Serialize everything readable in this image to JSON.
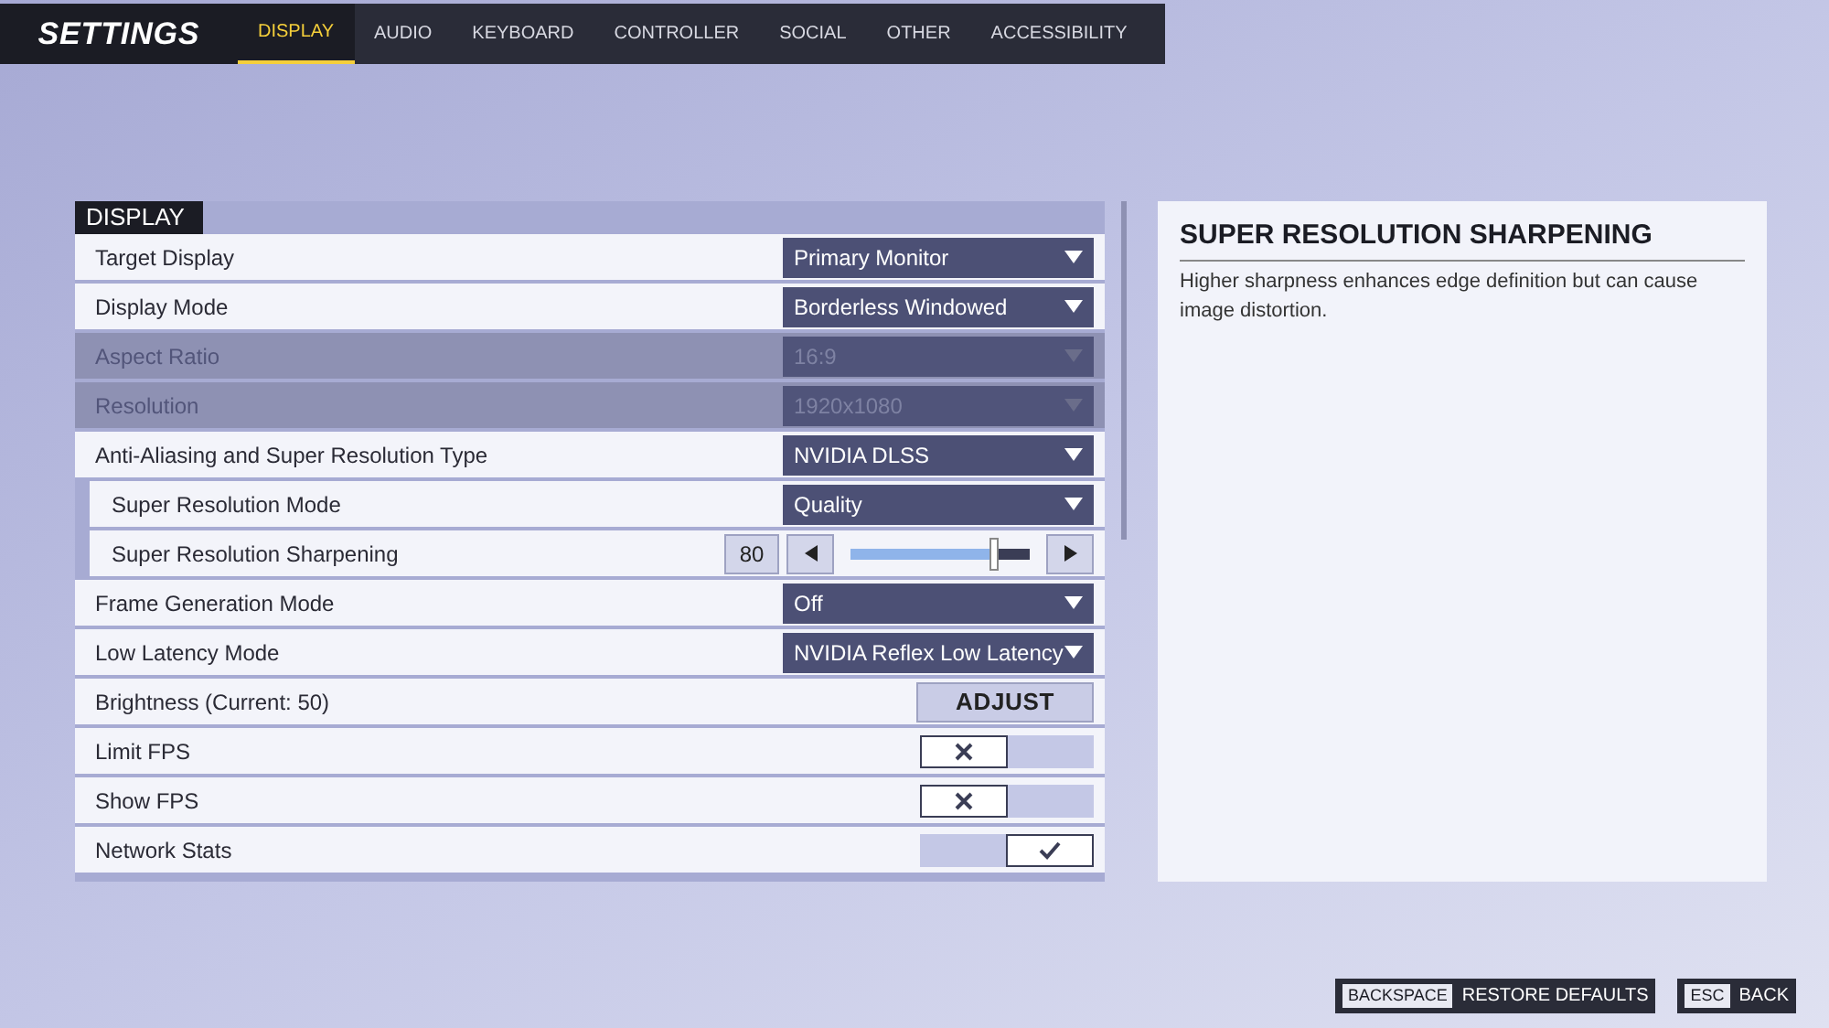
{
  "header": {
    "title": "SETTINGS",
    "tabs": [
      {
        "label": "DISPLAY",
        "selected": true
      },
      {
        "label": "AUDIO",
        "selected": false
      },
      {
        "label": "KEYBOARD",
        "selected": false
      },
      {
        "label": "CONTROLLER",
        "selected": false
      },
      {
        "label": "SOCIAL",
        "selected": false
      },
      {
        "label": "OTHER",
        "selected": false
      },
      {
        "label": "ACCESSIBILITY",
        "selected": false
      }
    ]
  },
  "section": {
    "title": "DISPLAY",
    "rows": [
      {
        "kind": "dropdown",
        "label": "Target Display",
        "value": "Primary Monitor",
        "disabled": false
      },
      {
        "kind": "dropdown",
        "label": "Display Mode",
        "value": "Borderless Windowed",
        "disabled": false
      },
      {
        "kind": "dropdown",
        "label": "Aspect Ratio",
        "value": "16:9",
        "disabled": true
      },
      {
        "kind": "dropdown",
        "label": "Resolution",
        "value": "1920x1080",
        "disabled": true
      },
      {
        "kind": "dropdown",
        "label": "Anti-Aliasing and Super Resolution Type",
        "value": "NVIDIA DLSS",
        "disabled": false,
        "children": [
          {
            "kind": "dropdown",
            "label": "Super Resolution Mode",
            "value": "Quality",
            "disabled": false
          },
          {
            "kind": "slider",
            "label": "Super Resolution Sharpening",
            "value": "80",
            "level": 0.8,
            "disabled": false
          }
        ]
      },
      {
        "kind": "dropdown",
        "label": "Frame Generation Mode",
        "value": "Off",
        "disabled": false
      },
      {
        "kind": "dropdown",
        "label": "Low Latency Mode",
        "value": "NVIDIA Reflex Low Latency",
        "disabled": false
      },
      {
        "kind": "button",
        "label": "Brightness (Current: 50)",
        "value": "ADJUST",
        "disabled": false
      },
      {
        "kind": "toggle",
        "label": "Limit FPS",
        "checked": false,
        "disabled": false
      },
      {
        "kind": "toggle",
        "label": "Show FPS",
        "checked": false,
        "disabled": false
      },
      {
        "kind": "toggle",
        "label": "Network Stats",
        "checked": true,
        "disabled": false
      }
    ]
  },
  "info": {
    "title": "SUPER RESOLUTION SHARPENING",
    "text": "Higher sharpness enhances edge definition but can cause image distortion."
  },
  "footer": [
    {
      "key": "BACKSPACE",
      "label": "RESTORE DEFAULTS"
    },
    {
      "key": "ESC",
      "label": "BACK"
    }
  ]
}
